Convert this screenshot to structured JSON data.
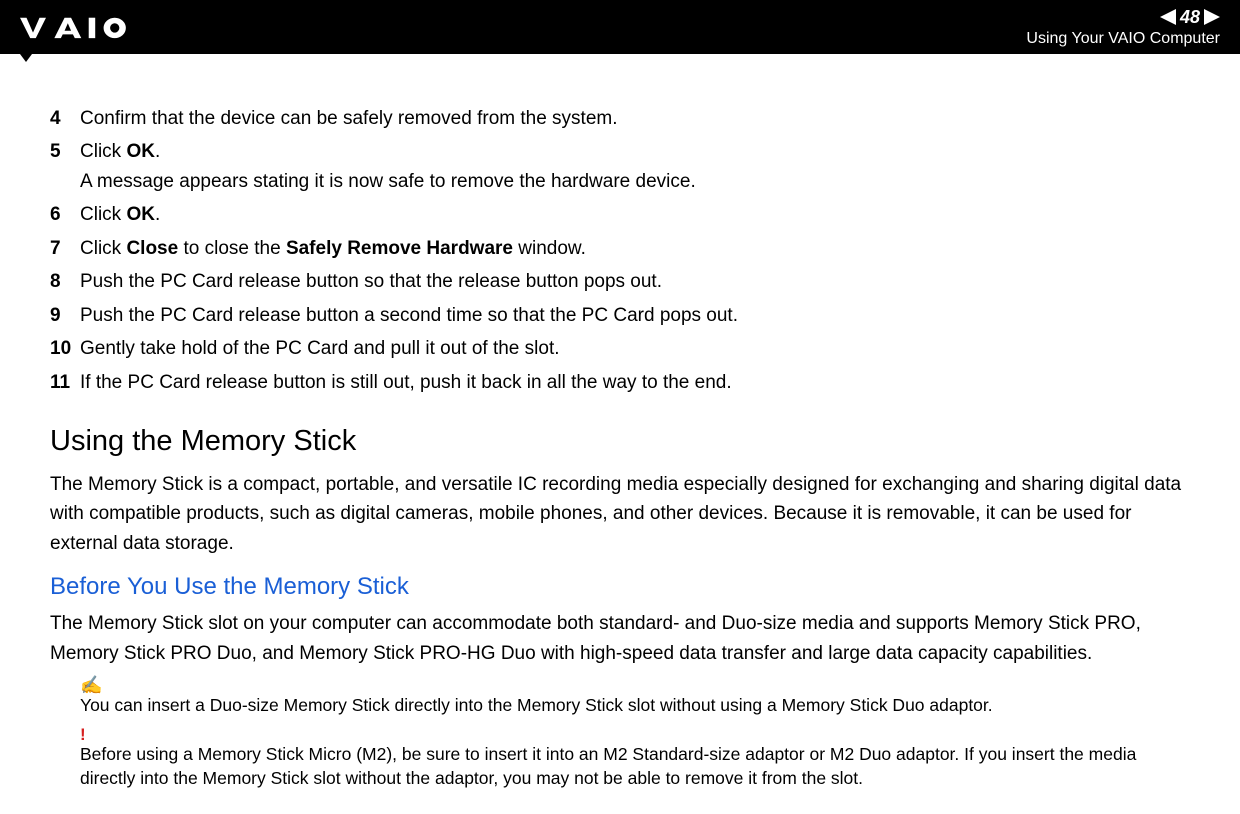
{
  "header": {
    "page_number": "48",
    "section_label": "Using Your VAIO Computer"
  },
  "steps": [
    {
      "num": "4",
      "text": "Confirm that the device can be safely removed from the system."
    },
    {
      "num": "5",
      "text_html": "Click <b>OK</b>.<br>A message appears stating it is now safe to remove the hardware device."
    },
    {
      "num": "6",
      "text_html": "Click <b>OK</b>."
    },
    {
      "num": "7",
      "text_html": "Click <b>Close</b> to close the <b>Safely Remove Hardware</b> window."
    },
    {
      "num": "8",
      "text": "Push the PC Card release button so that the release button pops out."
    },
    {
      "num": "9",
      "text": "Push the PC Card release button a second time so that the PC Card pops out."
    },
    {
      "num": "10",
      "text": "Gently take hold of the PC Card and pull it out of the slot."
    },
    {
      "num": "11",
      "text": "If the PC Card release button is still out, push it back in all the way to the end."
    }
  ],
  "h2_title": "Using the Memory Stick",
  "para1": "The Memory Stick is a compact, portable, and versatile IC recording media especially designed for exchanging and sharing digital data with compatible products, such as digital cameras, mobile phones, and other devices. Because it is removable, it can be used for external data storage.",
  "h3_title": "Before You Use the Memory Stick",
  "para2": "The Memory Stick slot on your computer can accommodate both standard- and Duo-size media and supports Memory Stick PRO, Memory Stick PRO Duo, and Memory Stick PRO-HG Duo with high-speed data transfer and large data capacity capabilities.",
  "note1": {
    "icon": "✍",
    "text": "You can insert a Duo-size Memory Stick directly into the Memory Stick slot without using a Memory Stick Duo adaptor."
  },
  "note2": {
    "icon": "!",
    "text": "Before using a Memory Stick Micro (M2), be sure to insert it into an M2 Standard-size adaptor or M2 Duo adaptor. If you insert the media directly into the Memory Stick slot without the adaptor, you may not be able to remove it from the slot."
  }
}
